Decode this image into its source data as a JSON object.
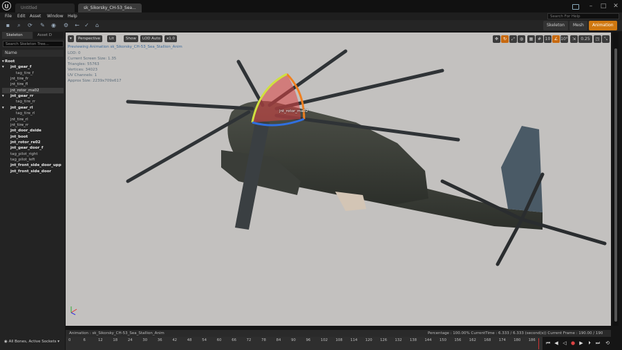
{
  "window": {
    "tab_untitled": "Untitled",
    "tab_asset": "sk_Sikorsky_CH-53_Sea...",
    "min": "–",
    "max": "□",
    "close": "✕"
  },
  "menu": [
    "File",
    "Edit",
    "Asset",
    "Window",
    "Help"
  ],
  "help_search_placeholder": "Search For Help",
  "modes": {
    "skeleton": "Skeleton",
    "mesh": "Mesh",
    "animation": "Animation"
  },
  "left_panel": {
    "tabs": [
      "Skeleton",
      "Asset D"
    ],
    "search_placeholder": "Search Skeleton Tree...",
    "column_name": "Name",
    "tree": [
      {
        "label": "Root",
        "indent": 0,
        "style": "bold",
        "arrow": "▾"
      },
      {
        "label": "jnt_gear_f",
        "indent": 1,
        "style": "bold",
        "arrow": "▾"
      },
      {
        "label": "tag_tire_f",
        "indent": 2,
        "style": "tag",
        "arrow": ""
      },
      {
        "label": "jnt_tire_fr",
        "indent": 1,
        "style": "normal",
        "arrow": ""
      },
      {
        "label": "jnt_tire_fl",
        "indent": 1,
        "style": "normal",
        "arrow": ""
      },
      {
        "label": "jnt_rotor_ma02",
        "indent": 1,
        "style": "sel",
        "arrow": ""
      },
      {
        "label": "jnt_gear_rr",
        "indent": 1,
        "style": "bold",
        "arrow": "▾"
      },
      {
        "label": "tag_tire_rr",
        "indent": 2,
        "style": "tag",
        "arrow": ""
      },
      {
        "label": "jnt_gear_rl",
        "indent": 1,
        "style": "bold",
        "arrow": "▾"
      },
      {
        "label": "tag_tire_rl",
        "indent": 2,
        "style": "tag",
        "arrow": ""
      },
      {
        "label": "jnt_tire_rl",
        "indent": 1,
        "style": "normal",
        "arrow": ""
      },
      {
        "label": "jnt_tire_rr",
        "indent": 1,
        "style": "normal",
        "arrow": ""
      },
      {
        "label": "jnt_door_dside",
        "indent": 1,
        "style": "bold",
        "arrow": ""
      },
      {
        "label": "jnt_boot",
        "indent": 1,
        "style": "bold",
        "arrow": ""
      },
      {
        "label": "jnt_rotor_re02",
        "indent": 1,
        "style": "bold",
        "arrow": ""
      },
      {
        "label": "jnt_gear_door_f",
        "indent": 1,
        "style": "bold",
        "arrow": ""
      },
      {
        "label": "tag_pilot_right",
        "indent": 1,
        "style": "tag",
        "arrow": ""
      },
      {
        "label": "tag_pilot_left",
        "indent": 1,
        "style": "tag",
        "arrow": ""
      },
      {
        "label": "jnt_front_side_door_upp",
        "indent": 1,
        "style": "bold",
        "arrow": ""
      },
      {
        "label": "jnt_front_side_door",
        "indent": 1,
        "style": "bold",
        "arrow": ""
      }
    ],
    "footer": "All Bones, Active Sockets"
  },
  "viewport": {
    "buttons": {
      "menu": "▾",
      "perspective": "Perspective",
      "lit": "Lit",
      "show": "Show",
      "lod": "LOD Auto",
      "speed": "x1.0"
    },
    "info": [
      "Previewing Animation sk_Sikorsky_CH-53_Sea_Stallion_Anim",
      "LOD: 0",
      "Current Screen Size: 1.35",
      "Triangles: 55763",
      "Vertices: 34023",
      "UV Channels: 1",
      "Approx Size: 2239x709x617"
    ],
    "bone_label": "jnt_rotor_ma02",
    "grid_size": "0.25"
  },
  "bottom_bar": {
    "animation_label": "Animation : sk_Sikorsky_CH-53_Sea_Stallion_Anim",
    "status": "Percentage : 100.00% CurrentTime : 6.333 / 6.333 (second(s)) Current Frame : 190.00 / 190 Frame"
  },
  "timeline": {
    "ticks": [
      "0",
      "6",
      "12",
      "18",
      "24",
      "30",
      "36",
      "42",
      "48",
      "54",
      "60",
      "66",
      "72",
      "78",
      "84",
      "90",
      "96",
      "102",
      "108",
      "114",
      "120",
      "126",
      "132",
      "138",
      "144",
      "150",
      "156",
      "162",
      "168",
      "174",
      "180",
      "186"
    ],
    "playhead_frame": 190,
    "max_frame": 190
  }
}
